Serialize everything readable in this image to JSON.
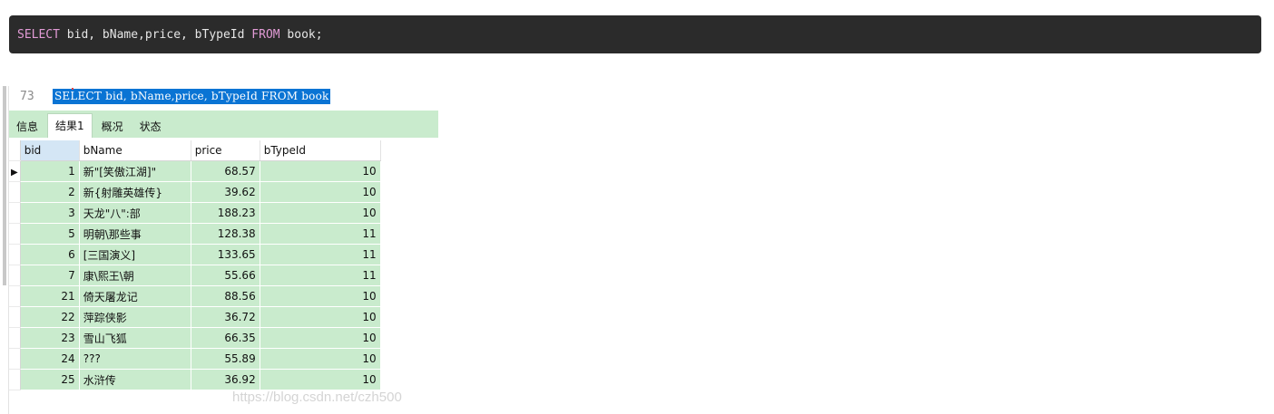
{
  "code_block": {
    "kw1": "SELECT",
    "text1": " bid, bName,price, bTypeId ",
    "kw2": "FROM",
    "text2": " book;"
  },
  "editor": {
    "line_number": "73",
    "selected_sql": "SELECT bid, bName,price, bTypeId FROM book"
  },
  "tabs": [
    {
      "label": "信息"
    },
    {
      "label": "结果1"
    },
    {
      "label": "概况"
    },
    {
      "label": "状态"
    }
  ],
  "grid": {
    "columns": [
      "bid",
      "bName",
      "price",
      "bTypeId"
    ],
    "rows": [
      {
        "bid": "1",
        "bName": "新\"[笑傲江湖]\"",
        "price": "68.57",
        "bTypeId": "10"
      },
      {
        "bid": "2",
        "bName": "新{射雕英雄传}",
        "price": "39.62",
        "bTypeId": "10"
      },
      {
        "bid": "3",
        "bName": "天龙\"八\":部",
        "price": "188.23",
        "bTypeId": "10"
      },
      {
        "bid": "5",
        "bName": "明朝\\那些事",
        "price": "128.38",
        "bTypeId": "11"
      },
      {
        "bid": "6",
        "bName": "[三国演义]",
        "price": "133.65",
        "bTypeId": "11"
      },
      {
        "bid": "7",
        "bName": "康\\熙王\\朝",
        "price": "55.66",
        "bTypeId": "11"
      },
      {
        "bid": "21",
        "bName": "倚天屠龙记",
        "price": "88.56",
        "bTypeId": "10"
      },
      {
        "bid": "22",
        "bName": "萍踪侠影",
        "price": "36.72",
        "bTypeId": "10"
      },
      {
        "bid": "23",
        "bName": "雪山飞狐",
        "price": "66.35",
        "bTypeId": "10"
      },
      {
        "bid": "24",
        "bName": "???",
        "price": "55.89",
        "bTypeId": "10"
      },
      {
        "bid": "25",
        "bName": "水浒传",
        "price": "36.92",
        "bTypeId": "10"
      }
    ]
  },
  "watermark": "https://blog.csdn.net/czh500",
  "row_indicator_icon": "current-row-arrow-icon"
}
